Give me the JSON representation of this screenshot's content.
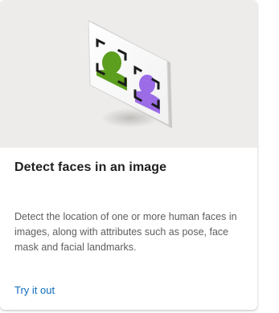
{
  "card": {
    "title": "Detect faces in an image",
    "description": "Detect the location of one or more human faces in images, along with attributes such as pose, face mask and facial landmarks.",
    "link_label": "Try it out"
  },
  "illustration": {
    "icon": "face-detection-illustration",
    "colors": {
      "background": "#edecea",
      "face_1": "#5c9e1e",
      "face_2": "#9b6ce6",
      "brackets": "#1b1b1b"
    }
  }
}
